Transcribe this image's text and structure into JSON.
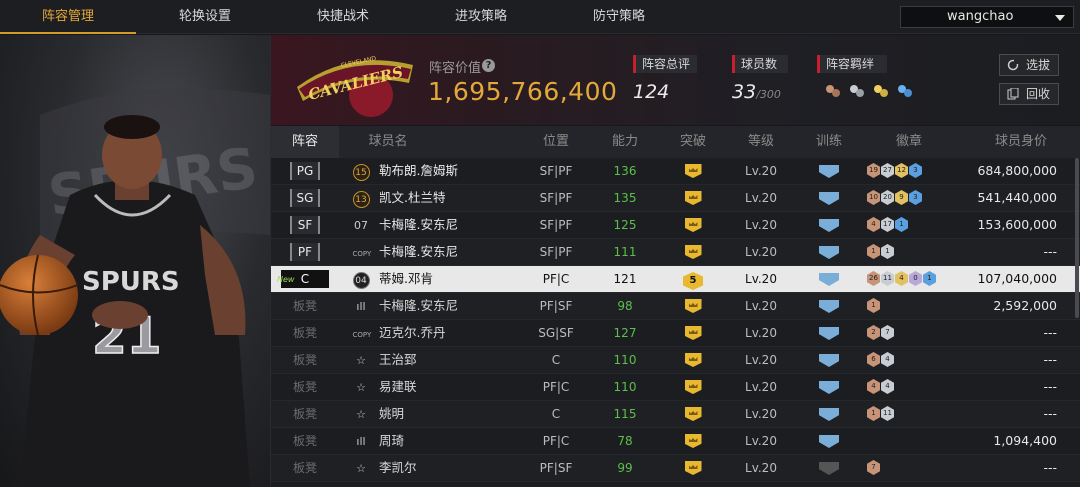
{
  "nav": {
    "tabs": [
      "阵容管理",
      "轮换设置",
      "快捷战术",
      "进攻策略",
      "防守策略"
    ],
    "active_index": 0,
    "user": "wangchao"
  },
  "header": {
    "value_label": "阵容价值",
    "value": "1,695,766,400",
    "rating_label": "阵容总评",
    "rating": "124",
    "players_label": "球员数",
    "players_count": "33",
    "players_max": "/300",
    "bond_label": "阵容羁绊",
    "btn_pick": "选拔",
    "btn_recycle": "回收",
    "team_logo": "CAVALIERS",
    "team_logo_sub": "CLEVELAND",
    "accent_color": "#e3a83a"
  },
  "player_art": {
    "jersey_text": "SPURS",
    "jersey_number": "21",
    "backdrop_text": "SPURS"
  },
  "table": {
    "headers": [
      "阵容",
      "球员名",
      "位置",
      "能力",
      "突破",
      "等级",
      "训练",
      "徽章",
      "球员身价"
    ],
    "rows": [
      {
        "pos": "PG",
        "tier": "15",
        "tier_style": "gold",
        "name": "勒布朗.詹姆斯",
        "role": "SF|PF",
        "ability": "136",
        "break": "",
        "level": "Lv.20",
        "train": "blue",
        "badges": [
          [
            "bronze",
            "19"
          ],
          [
            "silver",
            "27"
          ],
          [
            "gold",
            "12"
          ],
          [
            "blue",
            "3"
          ]
        ],
        "price": "684,800,000"
      },
      {
        "pos": "SG",
        "tier": "13",
        "tier_style": "gold",
        "name": "凯文.杜兰特",
        "role": "SF|PF",
        "ability": "135",
        "break": "",
        "level": "Lv.20",
        "train": "blue",
        "badges": [
          [
            "bronze",
            "10"
          ],
          [
            "silver",
            "20"
          ],
          [
            "gold",
            "9"
          ],
          [
            "blue",
            "3"
          ]
        ],
        "price": "541,440,000"
      },
      {
        "pos": "SF",
        "tier": "07",
        "tier_style": "plain",
        "name": "卡梅隆.安东尼",
        "role": "SF|PF",
        "ability": "125",
        "break": "",
        "level": "Lv.20",
        "train": "blue",
        "badges": [
          [
            "bronze",
            "4"
          ],
          [
            "silver",
            "17"
          ],
          [
            "blue",
            "1"
          ]
        ],
        "price": "153,600,000"
      },
      {
        "pos": "PF",
        "tier": "COPY",
        "tier_style": "copy",
        "name": "卡梅隆.安东尼",
        "role": "SF|PF",
        "ability": "111",
        "break": "",
        "level": "Lv.20",
        "train": "blue",
        "badges": [
          [
            "bronze",
            "1"
          ],
          [
            "silver",
            "1"
          ]
        ],
        "price": "---"
      },
      {
        "pos": "C",
        "tier": "04",
        "tier_style": "dark",
        "name": "蒂姆.邓肯",
        "role": "PF|C",
        "ability": "121",
        "break": "5",
        "level": "Lv.20",
        "train": "blue",
        "badges": [
          [
            "bronze",
            "26"
          ],
          [
            "silver",
            "11"
          ],
          [
            "gold",
            "4"
          ],
          [
            "purple",
            "0"
          ],
          [
            "blue",
            "1"
          ]
        ],
        "price": "107,040,000",
        "selected": true,
        "new_tag": "New"
      },
      {
        "pos": "板凳",
        "tier": "signal",
        "tier_style": "plain",
        "name": "卡梅隆.安东尼",
        "role": "PF|SF",
        "ability": "98",
        "break": "",
        "level": "Lv.20",
        "train": "blue",
        "badges": [
          [
            "bronze",
            "1"
          ]
        ],
        "price": "2,592,000"
      },
      {
        "pos": "板凳",
        "tier": "COPY",
        "tier_style": "copy",
        "name": "迈克尔.乔丹",
        "role": "SG|SF",
        "ability": "127",
        "break": "",
        "level": "Lv.20",
        "train": "blue",
        "badges": [
          [
            "bronze",
            "2"
          ],
          [
            "silver",
            "7"
          ]
        ],
        "price": "---"
      },
      {
        "pos": "板凳",
        "tier": "star",
        "tier_style": "plain",
        "name": "王治郅",
        "role": "C",
        "ability": "110",
        "break": "",
        "level": "Lv.20",
        "train": "blue",
        "badges": [
          [
            "bronze",
            "6"
          ],
          [
            "silver",
            "4"
          ]
        ],
        "price": "---"
      },
      {
        "pos": "板凳",
        "tier": "star",
        "tier_style": "plain",
        "name": "易建联",
        "role": "PF|C",
        "ability": "110",
        "break": "",
        "level": "Lv.20",
        "train": "blue",
        "badges": [
          [
            "bronze",
            "4"
          ],
          [
            "silver",
            "4"
          ]
        ],
        "price": "---"
      },
      {
        "pos": "板凳",
        "tier": "star",
        "tier_style": "plain",
        "name": "姚明",
        "role": "C",
        "ability": "115",
        "break": "",
        "level": "Lv.20",
        "train": "blue",
        "badges": [
          [
            "bronze",
            "1"
          ],
          [
            "silver",
            "11"
          ]
        ],
        "price": "---"
      },
      {
        "pos": "板凳",
        "tier": "signal",
        "tier_style": "plain",
        "name": "周琦",
        "role": "PF|C",
        "ability": "78",
        "break": "",
        "level": "Lv.20",
        "train": "blue",
        "badges": [],
        "price": "1,094,400"
      },
      {
        "pos": "板凳",
        "tier": "star",
        "tier_style": "plain",
        "name": "李凯尔",
        "role": "PF|SF",
        "ability": "99",
        "break": "",
        "level": "Lv.20",
        "train": "grey",
        "badges": [
          [
            "bronze",
            "7"
          ]
        ],
        "price": "---"
      }
    ]
  }
}
